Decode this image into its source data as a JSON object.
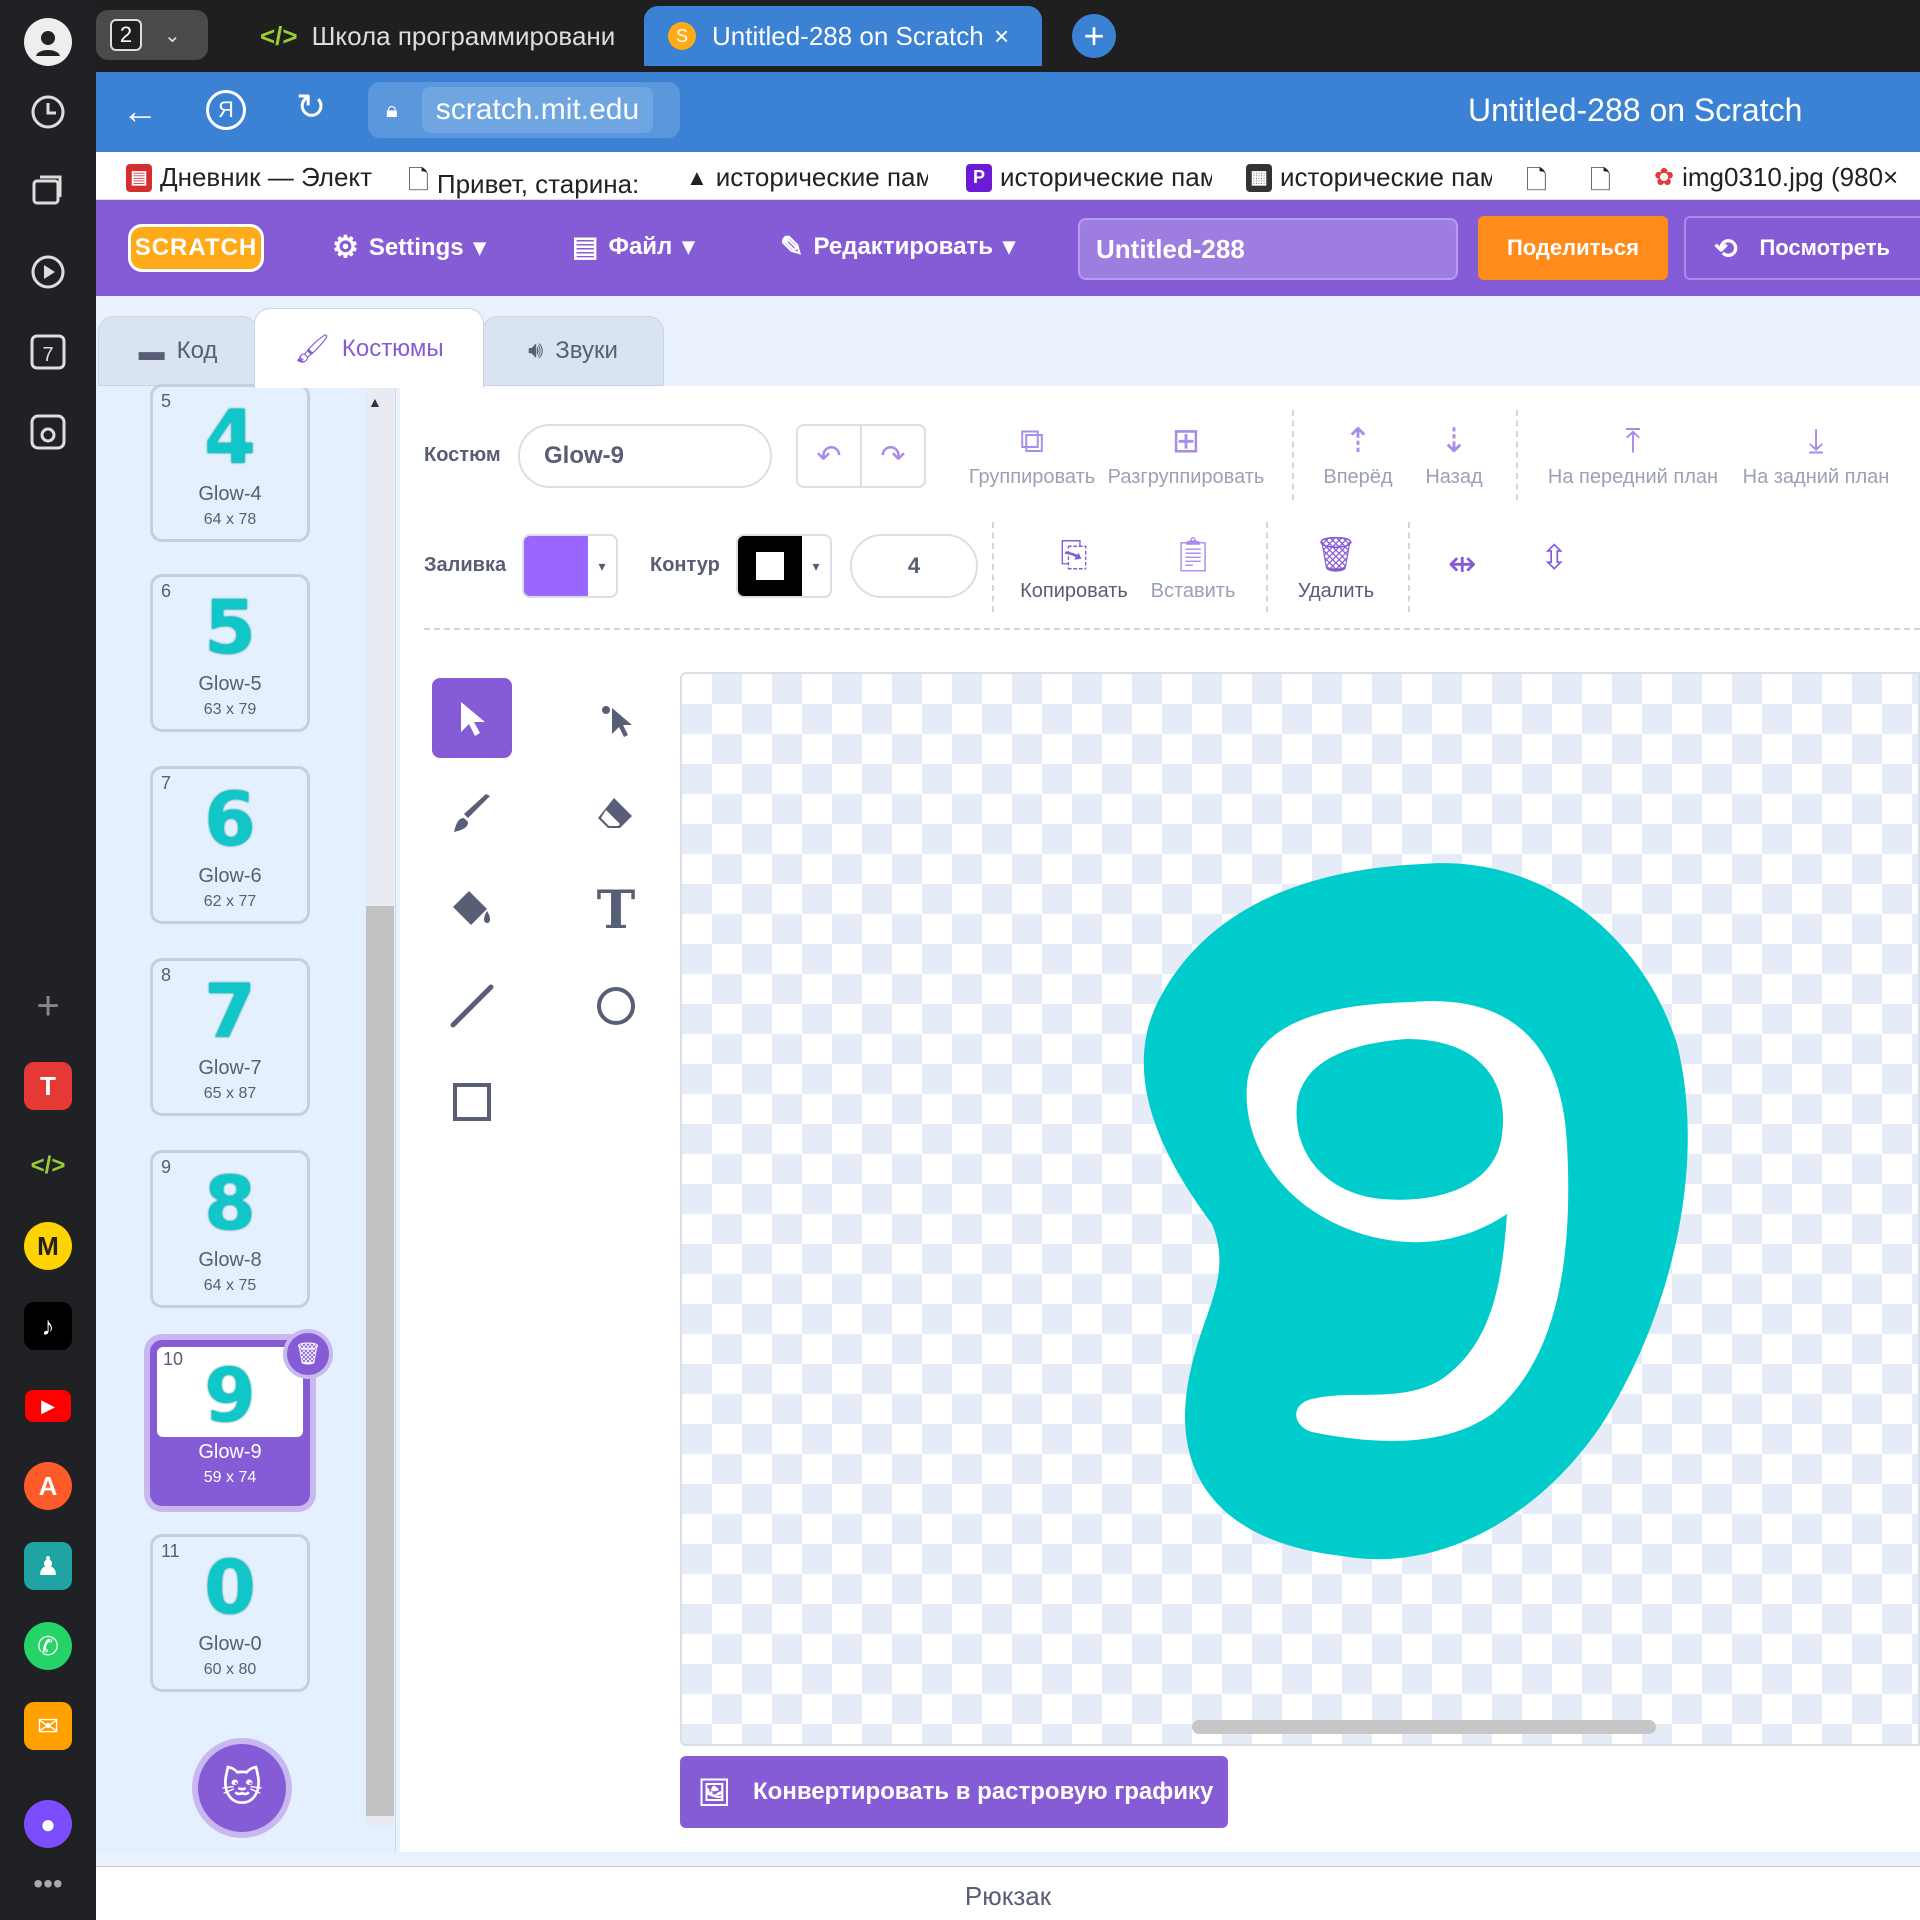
{
  "browser": {
    "tab_count": "2",
    "tabs": [
      {
        "label": "Школа программировани",
        "icon": "code-icon"
      },
      {
        "label": "Untitled-288 on Scratch",
        "icon": "scratch-icon"
      }
    ],
    "address": "scratch.mit.edu",
    "page_title": "Untitled-288 on Scratch",
    "bookmarks": [
      "Дневник — Элект",
      "Привет, старина:",
      "исторические пам",
      "исторические пам",
      "исторические пам",
      "",
      "",
      "img0310.jpg (980×"
    ]
  },
  "menu": {
    "logo": "SCRATCH",
    "settings": "Settings",
    "file": "Файл",
    "edit": "Редактировать",
    "project_title": "Untitled-288",
    "share": "Поделиться",
    "see_project": "Посмотреть"
  },
  "editor_tabs": {
    "code": "Код",
    "costumes": "Костюмы",
    "sounds": "Звуки"
  },
  "costumes": [
    {
      "num": "5",
      "glyph": "4",
      "name": "Glow-4",
      "size": "64 x 78"
    },
    {
      "num": "6",
      "glyph": "5",
      "name": "Glow-5",
      "size": "63 x 79"
    },
    {
      "num": "7",
      "glyph": "6",
      "name": "Glow-6",
      "size": "62 x 77"
    },
    {
      "num": "8",
      "glyph": "7",
      "name": "Glow-7",
      "size": "65 x 87"
    },
    {
      "num": "9",
      "glyph": "8",
      "name": "Glow-8",
      "size": "64 x 75"
    },
    {
      "num": "10",
      "glyph": "9",
      "name": "Glow-9",
      "size": "59 x 74",
      "selected": true
    },
    {
      "num": "11",
      "glyph": "0",
      "name": "Glow-0",
      "size": "60 x 80"
    }
  ],
  "paint": {
    "costume_label": "Костюм",
    "costume_name": "Glow-9",
    "group": "Группировать",
    "ungroup": "Разгруппировать",
    "forward": "Вперёд",
    "backward": "Назад",
    "front": "На передний план",
    "back": "На задний план",
    "fill_label": "Заливка",
    "fill_color": "#9966ff",
    "outline_label": "Контур",
    "outline_width": "4",
    "copy": "Копировать",
    "paste": "Вставить",
    "delete": "Удалить",
    "canvas_glyph": "9",
    "glyph_color": "#00cccc",
    "convert": "Конвертировать в растровую графику"
  },
  "footer": {
    "backpack": "Рюкзак"
  },
  "colors": {
    "scratch_purple": "#855cd6",
    "share_orange": "#ff8c1a",
    "browser_blue": "#3b82d4"
  }
}
